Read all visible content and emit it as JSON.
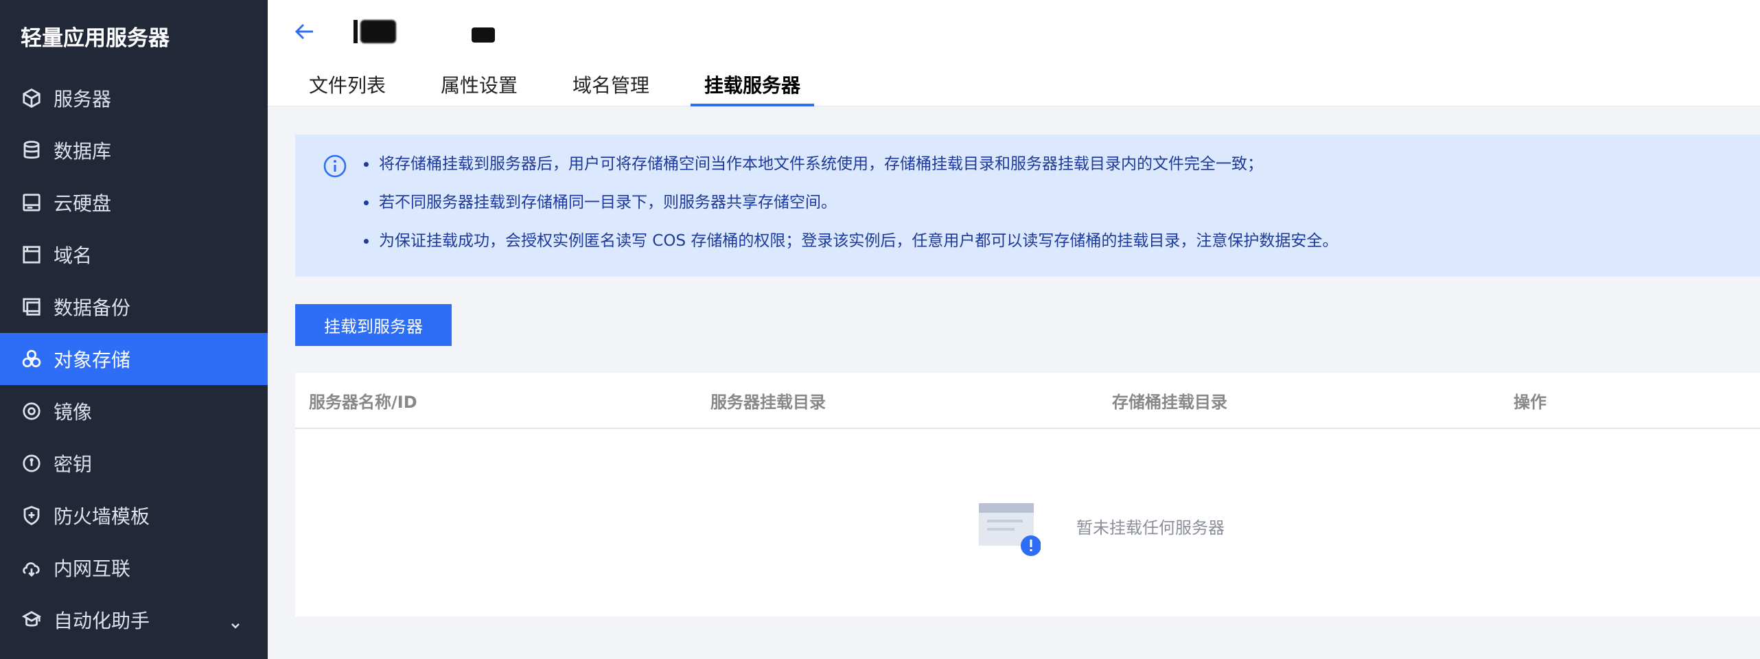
{
  "app_title": "轻量应用服务器",
  "sidebar": {
    "items": [
      {
        "label": "服务器",
        "icon": "cube-icon"
      },
      {
        "label": "数据库",
        "icon": "database-icon"
      },
      {
        "label": "云硬盘",
        "icon": "disk-icon"
      },
      {
        "label": "域名",
        "icon": "domain-icon"
      },
      {
        "label": "数据备份",
        "icon": "backup-icon"
      },
      {
        "label": "对象存储",
        "icon": "object-storage-icon",
        "active": true
      },
      {
        "label": "镜像",
        "icon": "image-icon"
      },
      {
        "label": "密钥",
        "icon": "key-icon"
      },
      {
        "label": "防火墙模板",
        "icon": "firewall-icon"
      },
      {
        "label": "内网互联",
        "icon": "network-icon"
      },
      {
        "label": "自动化助手",
        "icon": "automation-icon",
        "has_chevron": true
      }
    ]
  },
  "header": {
    "tabs": [
      "文件列表",
      "属性设置",
      "域名管理",
      "挂载服务器"
    ],
    "active_tab": "挂载服务器"
  },
  "notice": {
    "items": [
      "将存储桶挂载到服务器后，用户可将存储桶空间当作本地文件系统使用，存储桶挂载目录和服务器挂载目录内的文件完全一致；",
      "若不同服务器挂载到存储桶同一目录下，则服务器共享存储空间。",
      "为保证挂载成功，会授权实例匿名读写 COS 存储桶的权限；登录该实例后，任意用户都可以读写存储桶的挂载目录，注意保护数据安全。"
    ]
  },
  "mount_button_label": "挂载到服务器",
  "table": {
    "columns": [
      "服务器名称/ID",
      "服务器挂载目录",
      "存储桶挂载目录",
      "操作"
    ],
    "empty_text": "暂未挂载任何服务器"
  },
  "colors": {
    "accent": "#2e6df5",
    "sidebar_bg": "#232838",
    "notice_bg": "#dbe8fd",
    "notice_text": "#1e3a9a"
  }
}
